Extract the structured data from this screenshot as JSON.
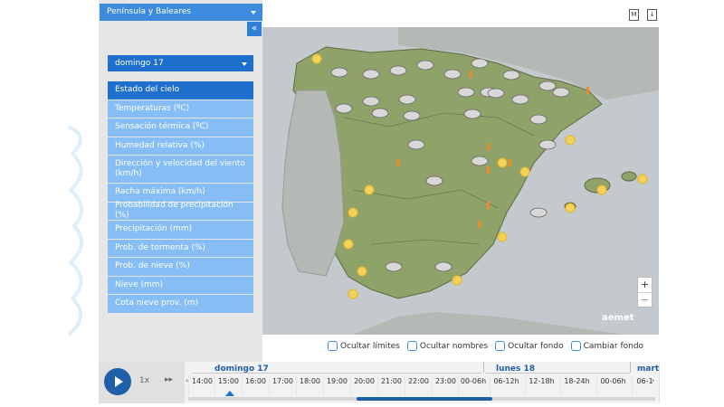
{
  "region_select": "Península y Baleares",
  "collapse_label": "«",
  "day_select": "domingo 17",
  "menu": [
    {
      "label": "Estado del cielo",
      "active": true
    },
    {
      "label": "Temperaturas (ºC)"
    },
    {
      "label": "Sensación térmica (ºC)"
    },
    {
      "label": "Humedad relativa (%)"
    },
    {
      "label": "Dirección y velocidad del viento (km/h)",
      "tall": true
    },
    {
      "label": "Racha máxima (km/h)"
    },
    {
      "label": "Probabilidad de precipitación (%)"
    },
    {
      "label": "Precipitación (mm)"
    },
    {
      "label": "Prob. de tormenta (%)"
    },
    {
      "label": "Prob. de nieve (%)"
    },
    {
      "label": "Nieve (mm)"
    },
    {
      "label": "Cota nieve prov. (m)"
    }
  ],
  "map_icons": [
    "M",
    "↓"
  ],
  "zoom": {
    "in": "+",
    "out": "−"
  },
  "logo": "aemet",
  "options": [
    "Ocultar límites",
    "Ocultar nombres",
    "Ocultar fondo",
    "Cambiar fondo"
  ],
  "timeline": {
    "speed": "1x",
    "ffw": "▸▸",
    "days": [
      "domingo 17",
      "lunes 18",
      "mart"
    ],
    "times": [
      "14:00",
      "15:00",
      "16:00",
      "17:00",
      "18:00",
      "19:00",
      "20:00",
      "21:00",
      "22:00",
      "23:00",
      "00-06h",
      "06-12h",
      "12-18h",
      "18-24h",
      "00-06h",
      "06-1"
    ],
    "selected": "15:00"
  },
  "colors": {
    "accent": "#1f6fcf",
    "menu": "#86bdf4",
    "panel": "#e6e6e6",
    "map_land": "#8fa26a",
    "map_sea": "#bfc5c8"
  }
}
